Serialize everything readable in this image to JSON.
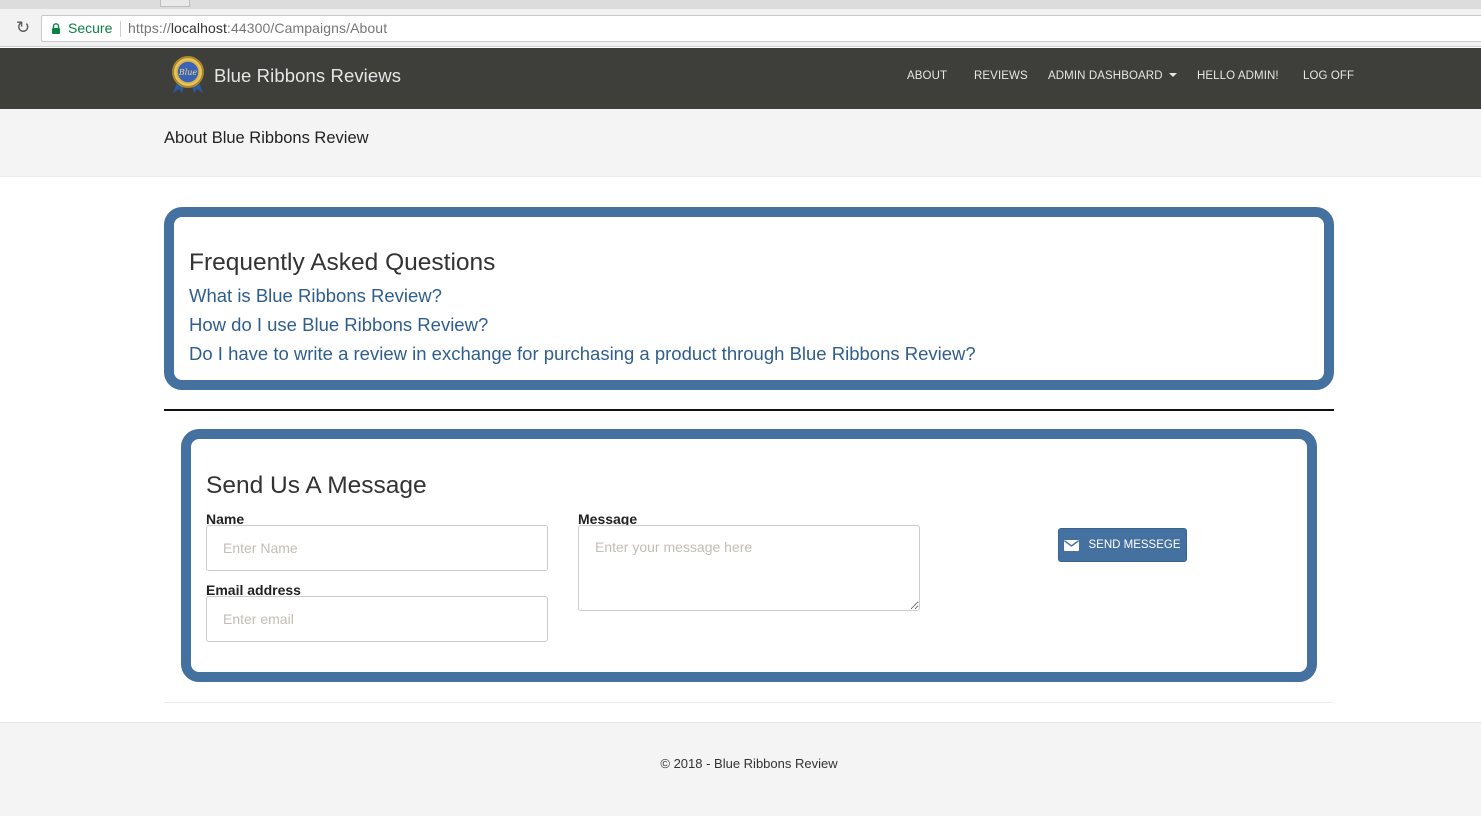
{
  "browser": {
    "secure_label": "Secure",
    "url_scheme": "https://",
    "url_host": "localhost",
    "url_rest": ":44300/Campaigns/About"
  },
  "navbar": {
    "brand": "Blue Ribbons Reviews",
    "links": [
      "About",
      "Reviews",
      "Admin Dashboard",
      "Hello Admin!",
      "Log off"
    ]
  },
  "page": {
    "title": "About Blue Ribbons Review"
  },
  "faq": {
    "title": "Frequently Asked Questions",
    "questions": [
      "What is Blue Ribbons Review?",
      "How do I use Blue Ribbons Review?",
      "Do I have to write a review in exchange for purchasing a product through Blue Ribbons Review?"
    ]
  },
  "contact": {
    "title": "Send Us A Message",
    "name_label": "Name",
    "name_placeholder": "Enter Name",
    "email_label": "Email address",
    "email_placeholder": "Enter email",
    "message_label": "Message",
    "message_placeholder": "Enter your message here",
    "send_label": "Send Messege"
  },
  "footer": {
    "copyright": "© 2018 - Blue Ribbons Review"
  },
  "colors": {
    "navbar": "#3e3e3b",
    "panel_border": "#44719f",
    "link": "#2f5e8e",
    "secure": "#0b8043"
  }
}
